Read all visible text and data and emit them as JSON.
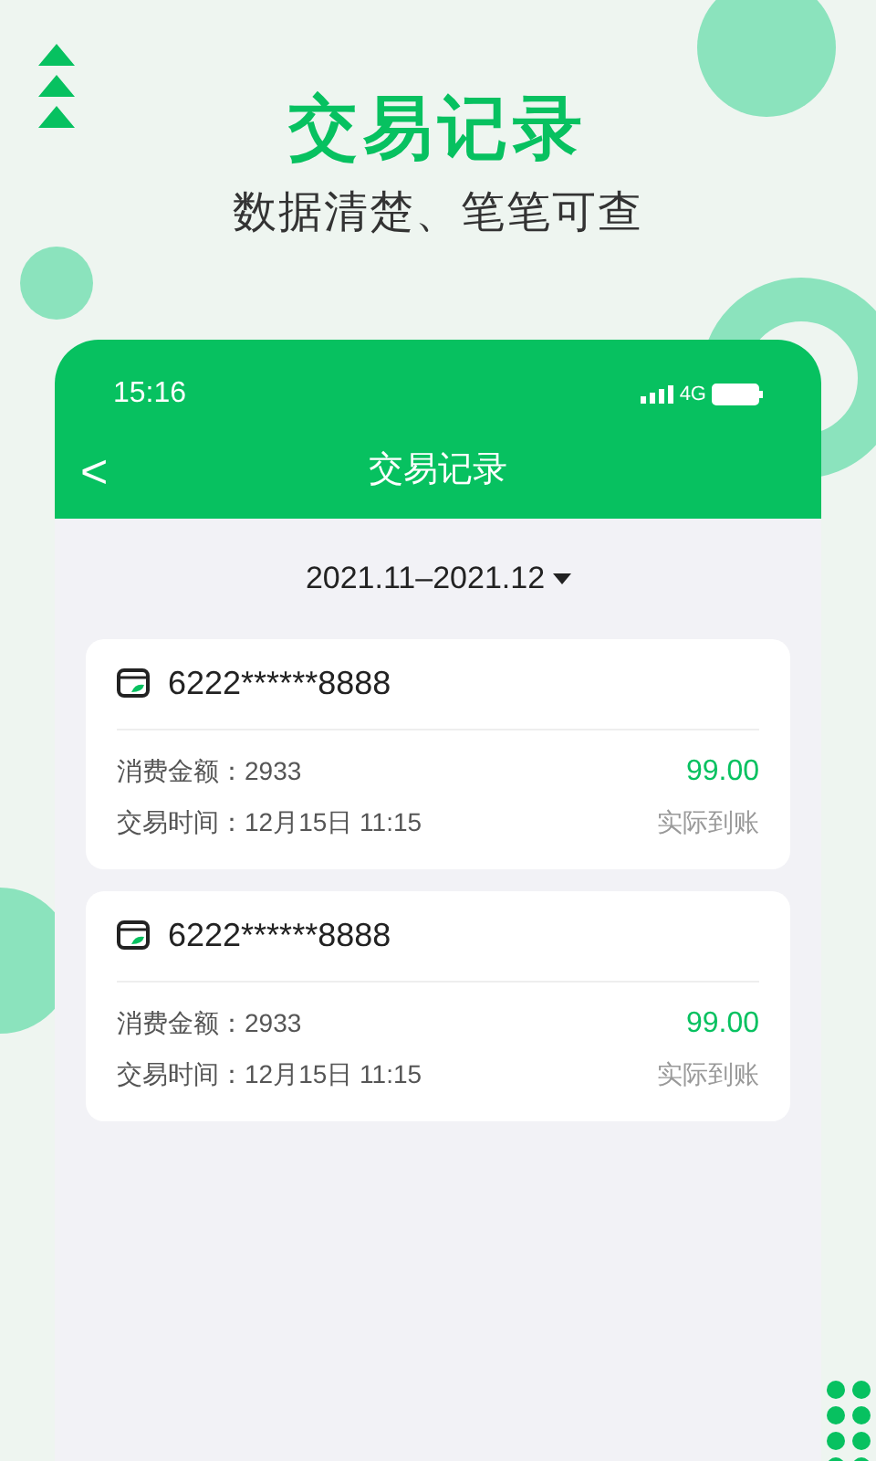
{
  "headline": "交易记录",
  "tagline": "数据清楚、笔笔可查",
  "status_bar": {
    "time": "15:16",
    "network": "4G"
  },
  "nav": {
    "back": "<",
    "title": "交易记录"
  },
  "date_range": {
    "label": "2021.11–2021.12"
  },
  "records": [
    {
      "card": "6222******8888",
      "amount_label": "消费金额：2933",
      "amount": "99.00",
      "time_label": "交易时间：12月15日 11:15",
      "status": "实际到账"
    },
    {
      "card": "6222******8888",
      "amount_label": "消费金额：2933",
      "amount": "99.00",
      "time_label": "交易时间：12月15日 11:15",
      "status": "实际到账"
    }
  ]
}
